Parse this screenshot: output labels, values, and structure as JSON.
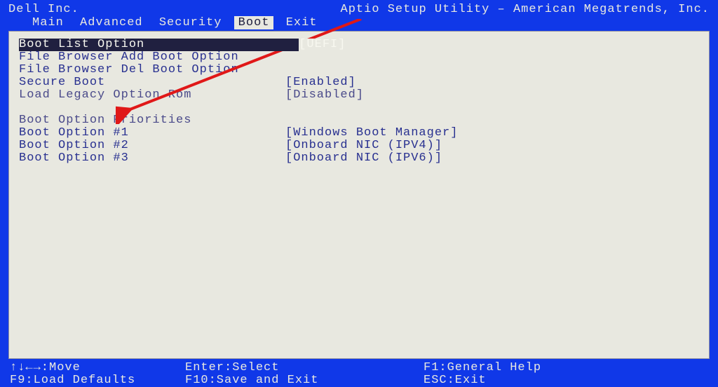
{
  "header": {
    "vendor": "Dell Inc.",
    "utility": "Aptio Setup Utility – American Megatrends, Inc."
  },
  "menu": {
    "tabs": [
      "Main",
      "Advanced",
      "Security",
      "Boot",
      "Exit"
    ],
    "active_index": 3
  },
  "boot": {
    "selected": {
      "label": "Boot List Option",
      "value": "[UEFI]"
    },
    "items": [
      {
        "label": "File Browser Add Boot Option",
        "value": ""
      },
      {
        "label": "File Browser Del Boot Option",
        "value": ""
      },
      {
        "label": "Secure Boot",
        "value": "[Enabled]"
      },
      {
        "label": "Load Legacy Option Rom",
        "value": "[Disabled]"
      }
    ],
    "priorities_header": "Boot Option Priorities",
    "priorities": [
      {
        "label": "Boot Option #1",
        "value": "[Windows Boot Manager]"
      },
      {
        "label": "Boot Option #2",
        "value": "[Onboard NIC (IPV4)]"
      },
      {
        "label": "Boot Option #3",
        "value": "[Onboard NIC (IPV6)]"
      }
    ]
  },
  "footer": {
    "row1": {
      "c1": "↑↓←→:Move",
      "c2": "Enter:Select",
      "c3": "F1:General Help"
    },
    "row2": {
      "c1": "F9:Load Defaults",
      "c2": "F10:Save and Exit",
      "c3": "ESC:Exit"
    }
  },
  "annotation": {
    "arrow_color": "#e01818"
  }
}
